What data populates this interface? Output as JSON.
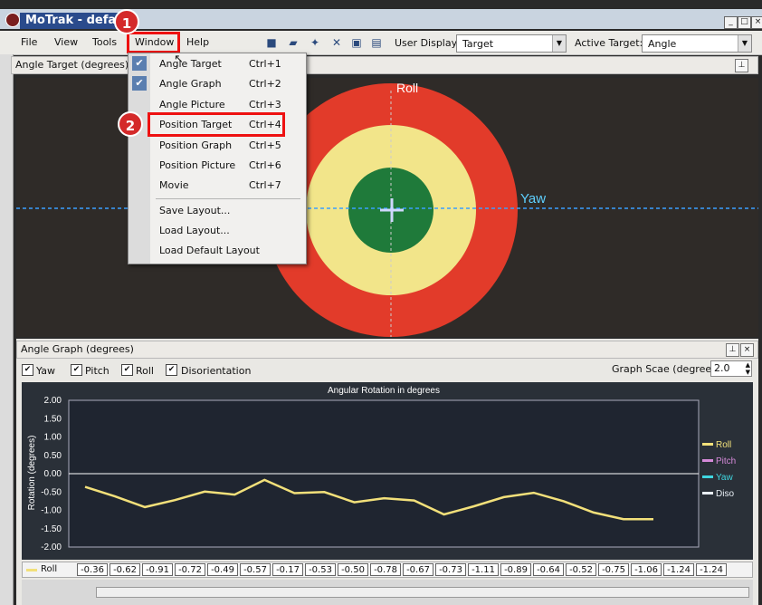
{
  "window": {
    "title": "MoTrak - defau"
  },
  "menubar": {
    "items": [
      "File",
      "View",
      "Tools",
      "Window",
      "Help"
    ],
    "user_display_label": "User Display:",
    "user_display_value": "Target",
    "active_target_label": "Active Target:",
    "active_target_value": "Angle"
  },
  "annotations": {
    "badge1": "1",
    "badge2": "2"
  },
  "target_panel": {
    "title": "Angle Target (degrees)",
    "roll_label": "Roll",
    "yaw_label": "Yaw",
    "colors": {
      "outer": "#e23b2a",
      "middle": "#f2e58a",
      "inner": "#1f7a3a"
    }
  },
  "window_menu": {
    "items": [
      {
        "label": "Angle Target",
        "shortcut": "Ctrl+1",
        "checked": true
      },
      {
        "label": "Angle Graph",
        "shortcut": "Ctrl+2",
        "checked": true
      },
      {
        "label": "Angle Picture",
        "shortcut": "Ctrl+3",
        "checked": false
      },
      {
        "label": "Position Target",
        "shortcut": "Ctrl+4",
        "checked": false
      },
      {
        "label": "Position Graph",
        "shortcut": "Ctrl+5",
        "checked": false
      },
      {
        "label": "Position Picture",
        "shortcut": "Ctrl+6",
        "checked": false
      },
      {
        "label": "Movie",
        "shortcut": "Ctrl+7",
        "checked": false
      }
    ],
    "layout_items": [
      "Save Layout...",
      "Load Layout...",
      "Load Default Layout"
    ]
  },
  "graph_panel": {
    "title": "Angle Graph (degrees)",
    "checkboxes": [
      "Yaw",
      "Pitch",
      "Roll",
      "Disorientation"
    ],
    "scale_label": "Graph Scae (degree)",
    "scale_value": "2.0"
  },
  "chart_data": {
    "type": "line",
    "title": "Angular Rotation in degrees",
    "ylabel": "Rotation (degrees)",
    "ylim": [
      -2.0,
      2.0
    ],
    "yticks": [
      "2.00",
      "1.50",
      "1.00",
      "0.50",
      "0.00",
      "-0.50",
      "-1.00",
      "-1.50",
      "-2.00"
    ],
    "legend": [
      "Roll",
      "Pitch",
      "Yaw",
      "Diso"
    ],
    "legend_colors": [
      "#f2e07a",
      "#d58ad8",
      "#3fd6e0",
      "#e8eef4"
    ],
    "series": [
      {
        "name": "Roll",
        "color": "#f2e07a",
        "values": [
          -0.36,
          -0.62,
          -0.91,
          -0.72,
          -0.49,
          -0.57,
          -0.17,
          -0.53,
          -0.5,
          -0.78,
          -0.67,
          -0.73,
          -1.11,
          -0.89,
          -0.64,
          -0.52,
          -0.75,
          -1.06,
          -1.24,
          -1.24
        ]
      }
    ],
    "value_row_label": "Roll",
    "value_row": [
      "-0.36",
      "-0.62",
      "-0.91",
      "-0.72",
      "-0.49",
      "-0.57",
      "-0.17",
      "-0.53",
      "-0.50",
      "-0.78",
      "-0.67",
      "-0.73",
      "-1.11",
      "-0.89",
      "-0.64",
      "-0.52",
      "-0.75",
      "-1.06",
      "-1.24",
      "-1.24"
    ]
  }
}
